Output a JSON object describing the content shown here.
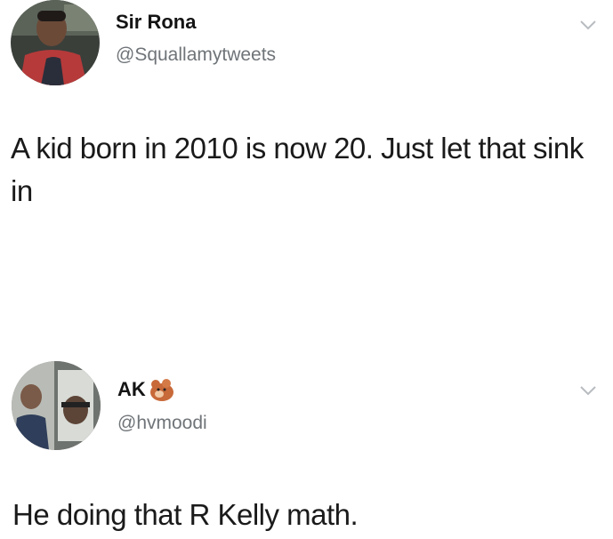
{
  "tweets": [
    {
      "display_name": "Sir Rona",
      "handle": "@Squallamytweets",
      "text": "A kid born in 2010 is now 20. Just let that sink in",
      "avatar_icon": "user-avatar-photo",
      "menu_icon": "chevron-down-icon"
    },
    {
      "display_name": "AK",
      "name_emoji": "hamster-emoji-icon",
      "handle": "@hvmoodi",
      "text": "He doing that R Kelly math.",
      "avatar_icon": "user-avatar-photo",
      "menu_icon": "chevron-down-icon"
    }
  ],
  "colors": {
    "background": "#ffffff",
    "name_text": "#141414",
    "handle_text": "#6f7478",
    "body_text": "#1a1a1a",
    "chevron": "#b8bcc0"
  }
}
